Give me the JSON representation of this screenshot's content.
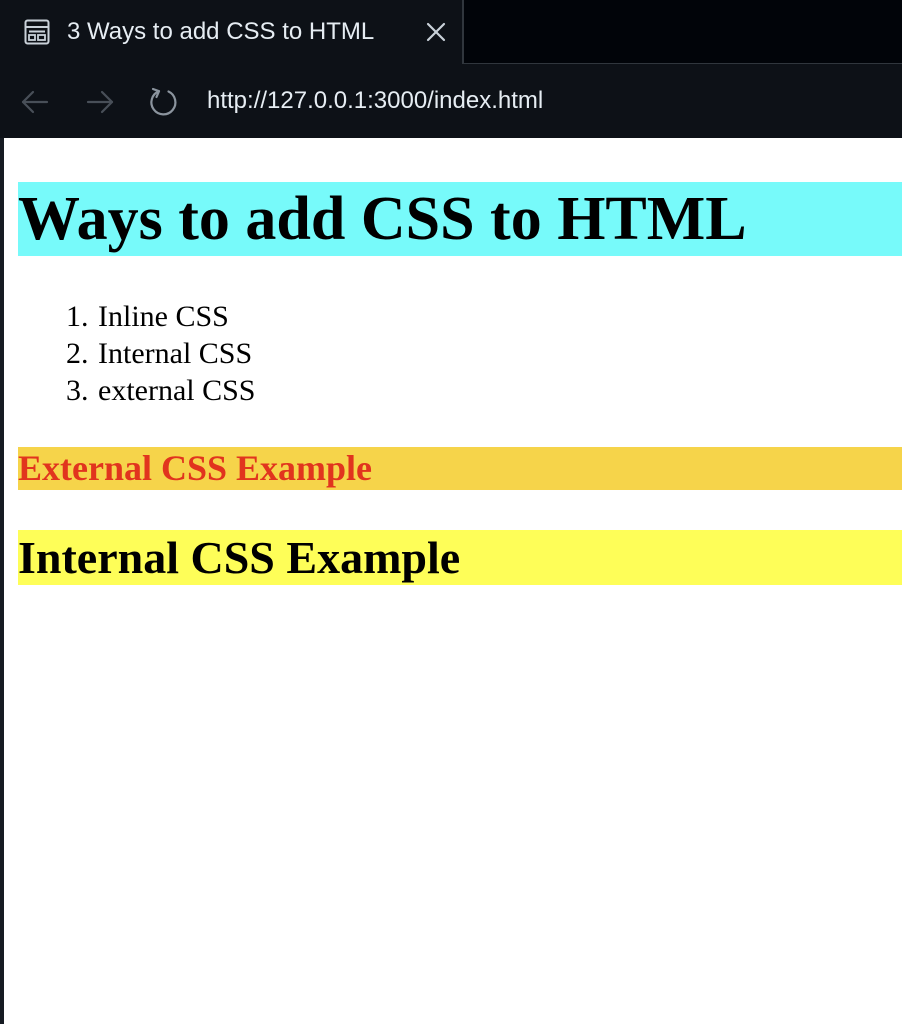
{
  "browser": {
    "tab": {
      "title": "3 Ways to add CSS to HTML",
      "icon": "page-icon",
      "close_icon": "close-icon"
    },
    "nav": {
      "back_icon": "arrow-left-icon",
      "forward_icon": "arrow-right-icon",
      "reload_icon": "reload-icon"
    },
    "url": "http://127.0.0.1:3000/index.html"
  },
  "page": {
    "heading": {
      "text": "Ways to add CSS to HTML",
      "background": "#77fafa"
    },
    "list": {
      "items": [
        {
          "number": "1.",
          "label": "Inline CSS"
        },
        {
          "number": "2.",
          "label": "Internal CSS"
        },
        {
          "number": "3.",
          "label": "external CSS"
        }
      ]
    },
    "external_example": {
      "text": "External CSS Example",
      "background": "#f6d44a",
      "color": "#e1341e"
    },
    "internal_example": {
      "text": "Internal CSS Example",
      "background": "#fefe58"
    }
  }
}
